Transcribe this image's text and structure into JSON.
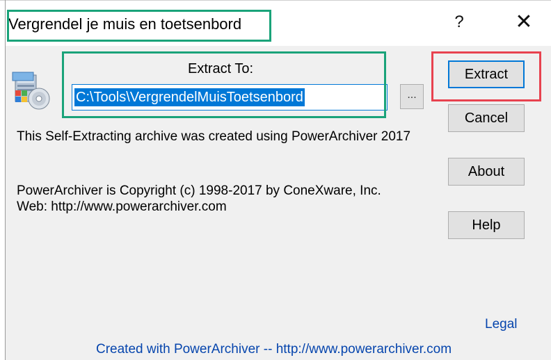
{
  "window": {
    "title": "Vergrendel je muis en toetsenbord",
    "help_glyph": "?",
    "close_glyph": "✕"
  },
  "extract": {
    "label": "Extract To:",
    "path_value": "C:\\Tools\\VergrendelMuisToetsenbord",
    "browse_label": "..."
  },
  "info": {
    "line1": "This Self-Extracting archive was created using PowerArchiver 2017",
    "line2": "PowerArchiver is Copyright (c) 1998-2017 by ConeXware, Inc.",
    "line3": "Web: http://www.powerarchiver.com"
  },
  "buttons": {
    "extract": "Extract",
    "cancel": "Cancel",
    "about": "About",
    "help": "Help"
  },
  "links": {
    "legal": "Legal",
    "footer": "Created with PowerArchiver  --  http://www.powerarchiver.com"
  },
  "colors": {
    "accent": "#0078d7",
    "highlight_green": "#1aa37a",
    "highlight_red": "#e8424f",
    "link": "#0645ad"
  },
  "icons": {
    "app": "archive-installer-icon"
  }
}
